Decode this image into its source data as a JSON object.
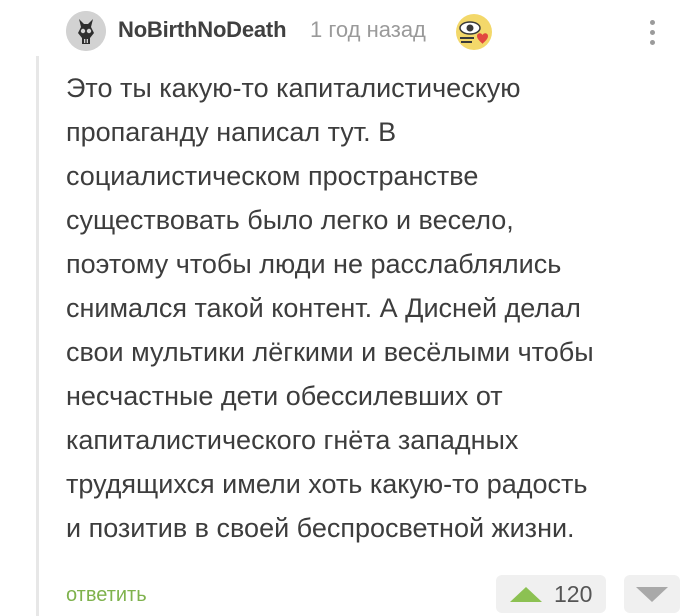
{
  "comment": {
    "author": "NoBirthNoDeath",
    "timestamp": "1 год назад",
    "avatar_icon": "skull-avatar",
    "award_icon": "eye-heart-award-icon",
    "menu_icon": "more-vertical-icon",
    "body_lines": [
      "Это ты какую-то капиталистическую",
      "пропаганду написал тут. В",
      "социалистическом пространстве",
      "существовать было легко и весело,",
      "поэтому чтобы люди не расслаблялись",
      "снимался такой контент. А Дисней делал",
      "свои мультики лёгкими и весёлыми чтобы",
      "несчастные дети обессилевших от",
      "капиталистического гнёта западных",
      "трудящихся имели хоть какую-то радость",
      "и позитив в своей беспросветной жизни."
    ],
    "reply_label": "ответить",
    "rating": "120",
    "upvote_icon": "upvote-triangle-icon",
    "downvote_icon": "downvote-triangle-icon"
  },
  "colors": {
    "accent_green": "#8cc152",
    "reply_green": "#7fb24d",
    "text": "#3d3d3d",
    "meta_gray": "#9a9a9a"
  }
}
